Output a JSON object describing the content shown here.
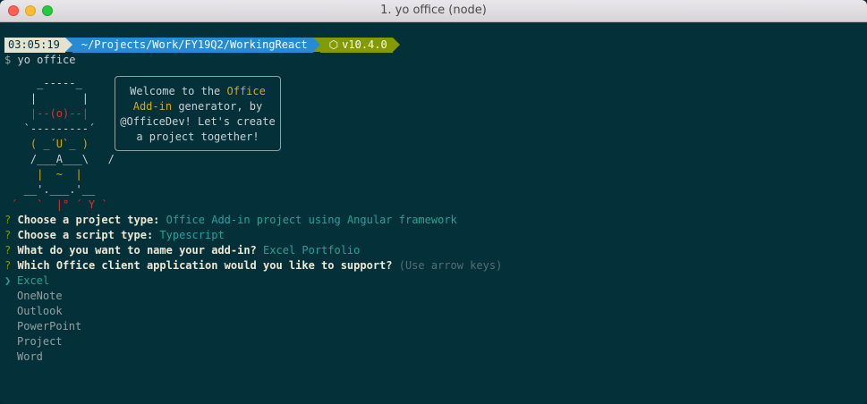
{
  "window": {
    "title": "1. yo office (node)"
  },
  "prompt": {
    "time": "03:05:19",
    "path": "~/Projects/Work/FY19Q2/WorkingReact",
    "node_version": "v10.4.0",
    "node_icon": "⬡",
    "symbol": "$",
    "command": "yo office"
  },
  "yeoman": {
    "art": [
      "     _-----_     ",
      "    |       |    ",
      "    |--(o)--|    ",
      "   `---------´   ",
      "    ( _´U`_ )    ",
      "    /___A___\\   /",
      "     |  ~  |     ",
      "   __'.___.'__   ",
      " ´   `  |° ´ Y ` "
    ],
    "bubble": [
      {
        "pre": "Welcome to the ",
        "hl": "Office",
        "post": ""
      },
      {
        "pre": "",
        "hl": "Add-in",
        "post": " generator, by"
      },
      {
        "pre": "@OfficeDev! Let's create",
        "hl": "",
        "post": ""
      },
      {
        "pre": "a project together!",
        "hl": "",
        "post": ""
      }
    ]
  },
  "questions": [
    {
      "mark": "?",
      "text": "Choose a project type:",
      "answer": "Office Add-in project using Angular framework",
      "hint": ""
    },
    {
      "mark": "?",
      "text": "Choose a script type:",
      "answer": "Typescript",
      "hint": ""
    },
    {
      "mark": "?",
      "text": "What do you want to name your add-in?",
      "answer": "Excel Portfolio",
      "hint": ""
    },
    {
      "mark": "?",
      "text": "Which Office client application would you like to support?",
      "answer": "",
      "hint": "(Use arrow keys)"
    }
  ],
  "options": {
    "pointer": "❯",
    "items": [
      "Excel",
      "OneNote",
      "Outlook",
      "PowerPoint",
      "Project",
      "Word"
    ],
    "selected_index": 0
  }
}
